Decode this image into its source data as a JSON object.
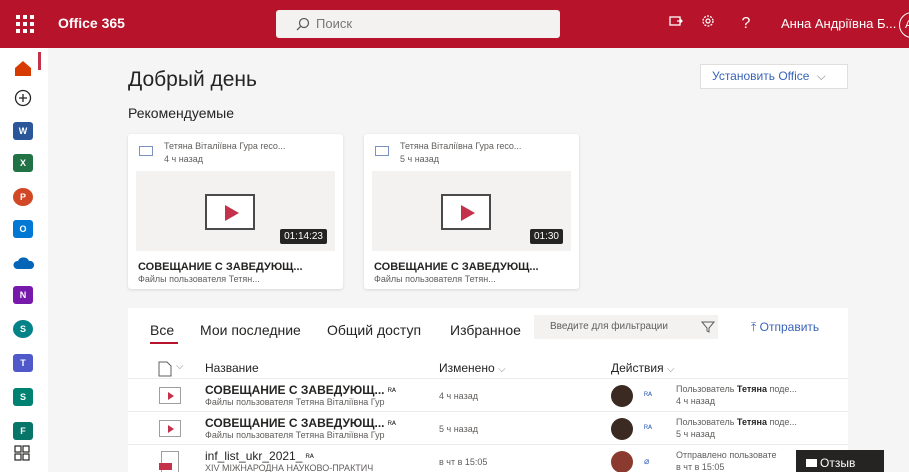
{
  "topbar": {
    "app_name": "Office 365",
    "search_placeholder": "Поиск",
    "user_name": "Анна Андріївна Б...",
    "avatar_initials": "А"
  },
  "rail": {
    "items": [
      {
        "name": "home",
        "label": ""
      },
      {
        "name": "create",
        "label": ""
      },
      {
        "name": "word",
        "label": "W"
      },
      {
        "name": "excel",
        "label": "X"
      },
      {
        "name": "powerpoint",
        "label": "P"
      },
      {
        "name": "outlook",
        "label": "O"
      },
      {
        "name": "onedrive",
        "label": ""
      },
      {
        "name": "onenote",
        "label": "N"
      },
      {
        "name": "sharepoint",
        "label": "S"
      },
      {
        "name": "teams",
        "label": "T"
      },
      {
        "name": "sway",
        "label": "S"
      },
      {
        "name": "forms",
        "label": "F"
      },
      {
        "name": "all-apps",
        "label": ""
      }
    ]
  },
  "main": {
    "greeting": "Добрый день",
    "install_label": "Установить Office",
    "recommended_title": "Рекомендуемые",
    "cards": [
      {
        "author": "Тетяна Віталіївна Гура reco...",
        "time": "4 ч назад",
        "duration": "01:14:23",
        "title": "СОВЕЩАНИЕ С ЗАВЕДУЮЩ...",
        "subtitle": "Файлы пользователя Тетян..."
      },
      {
        "author": "Тетяна Віталіївна Гура reco...",
        "time": "5 ч назад",
        "duration": "01:30",
        "title": "СОВЕЩАНИЕ С ЗАВЕДУЮЩ...",
        "subtitle": "Файлы пользователя Тетян..."
      }
    ]
  },
  "files": {
    "tabs": [
      "Все",
      "Мои последние",
      "Общий доступ",
      "Избранное"
    ],
    "filter_placeholder": "Введите для фильтрации",
    "send_label": "Отправить",
    "headers": {
      "name": "Название",
      "modified": "Изменено",
      "actions": "Действия"
    },
    "rows": [
      {
        "title": "СОВЕЩАНИЕ С ЗАВЕДУЮЩ...",
        "subtitle": "Файлы пользователя Тетяна Віталіївна Гур",
        "modified": "4 ч назад",
        "action_prefix": "Пользователь ",
        "action_user": "Тетяна",
        "action_suffix": " поде...",
        "action_time": "4 ч назад"
      },
      {
        "title": "СОВЕЩАНИЕ С ЗАВЕДУЮЩ...",
        "subtitle": "Файлы пользователя Тетяна Віталіївна Гур",
        "modified": "5 ч назад",
        "action_prefix": "Пользователь ",
        "action_user": "Тетяна",
        "action_suffix": " поде...",
        "action_time": "5 ч назад"
      },
      {
        "title": "inf_list_ukr_2021_",
        "subtitle": "XIV МІЖНАРОДНА НАУКОВО-ПРАКТИЧ",
        "modified": "в чт в 15:05",
        "action_prefix": "Отправлено пользовате",
        "action_user": "",
        "action_suffix": "",
        "action_time": "в чт в 15:05"
      }
    ]
  },
  "feedback_label": "Отзыв",
  "colors": {
    "brand": "#b7132a",
    "accent": "#3864b7"
  }
}
